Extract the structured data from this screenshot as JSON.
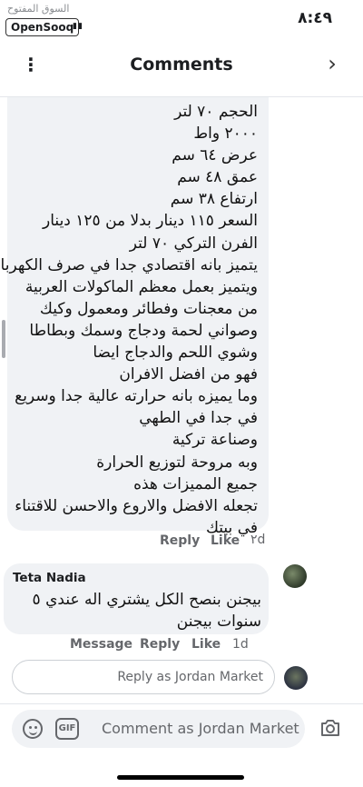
{
  "status_bar": {
    "time": "٨:٤٩",
    "watermark_arabic": "السوق المفتوح",
    "watermark_logo": "OpenSooq"
  },
  "header": {
    "title": "Comments",
    "more_icon": "more-vertical-icon",
    "back_icon": "chevron-right-icon"
  },
  "comments": [
    {
      "lines": [
        "الحجم ٧٠ لتر",
        "٢٠٠٠ واط",
        "عرض ٦٤ سم",
        "عمق ٤٨ سم",
        "ارتفاع ٣٨ سم",
        "السعر ١١٥ دينار بدلا من ١٢٥ دينار",
        "الفرن التركي ٧٠ لتر",
        "يتميز بانه اقتصادي جدا في صرف الكهربا",
        "ويتميز بعمل معظم الماكولات العربية",
        "من معجنات وفطائر ومعمول وكيك",
        "وصواني لحمة ودجاج وسمك وبطاطا",
        "وشوي اللحم والدجاج ايضا",
        "فهو من افضل الافران",
        "وما يميزه بانه حرارته عالية جدا وسريع",
        "في جدا في الطهي",
        "وصناعة تركية",
        "وبه مروحة لتوزيع الحرارة",
        "جميع المميزات هذه",
        "تجعله الافضل والاروع والاحسن للاقتناء",
        "في بيتك"
      ],
      "actions": {
        "reply": "Reply",
        "like": "Like",
        "time": "٢d"
      }
    },
    {
      "author": "Teta Nadia",
      "lines": [
        "بيجنن بنصح الكل يشتري اله عندي ٥",
        "سنوات بيجنن"
      ],
      "actions": {
        "message": "Message",
        "reply": "Reply",
        "like": "Like",
        "time": "1d"
      }
    }
  ],
  "reply_box": {
    "placeholder": "Reply as Jordan Market"
  },
  "composer": {
    "placeholder": "Comment as Jordan Market",
    "gif_label": "GIF",
    "icons": [
      "emoji-icon",
      "gif-icon",
      "camera-icon"
    ]
  }
}
